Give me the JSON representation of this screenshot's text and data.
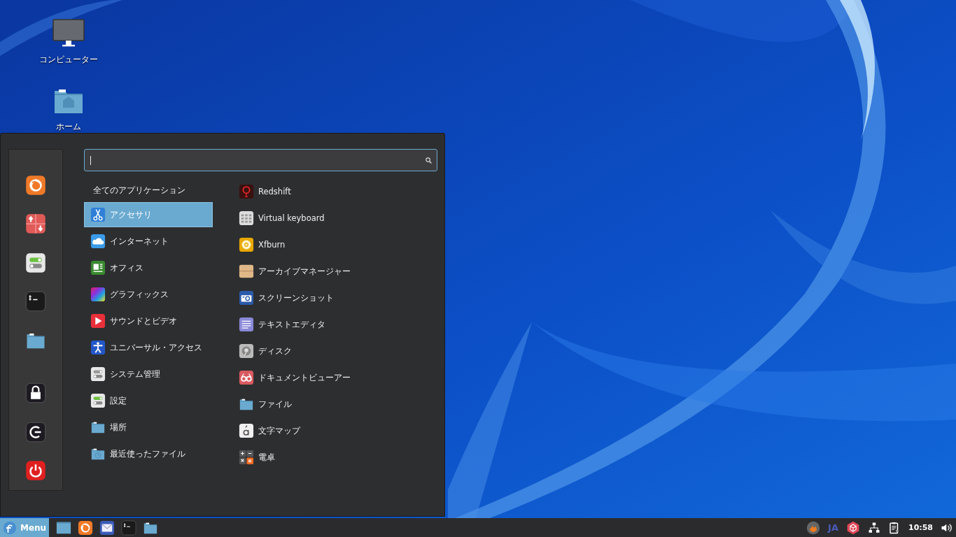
{
  "desktop_icons": [
    {
      "label": "コンピューター"
    },
    {
      "label": "ホーム"
    }
  ],
  "menu": {
    "categories_header": "全てのアプリケーション",
    "categories": [
      {
        "label": "アクセサリ",
        "selected": true
      },
      {
        "label": "インターネット",
        "selected": false
      },
      {
        "label": "オフィス",
        "selected": false
      },
      {
        "label": "グラフィックス",
        "selected": false
      },
      {
        "label": "サウンドとビデオ",
        "selected": false
      },
      {
        "label": "ユニバーサル・アクセス",
        "selected": false
      },
      {
        "label": "システム管理",
        "selected": false
      },
      {
        "label": "設定",
        "selected": false
      },
      {
        "label": "場所",
        "selected": false
      },
      {
        "label": "最近使ったファイル",
        "selected": false
      }
    ],
    "applications": [
      {
        "label": "Redshift"
      },
      {
        "label": "Virtual keyboard"
      },
      {
        "label": "Xfburn"
      },
      {
        "label": "アーカイブマネージャー"
      },
      {
        "label": "スクリーンショット"
      },
      {
        "label": "テキストエディタ"
      },
      {
        "label": "ディスク"
      },
      {
        "label": "ドキュメントビューアー"
      },
      {
        "label": "ファイル"
      },
      {
        "label": "文字マップ"
      },
      {
        "label": "電卓"
      }
    ]
  },
  "taskbar": {
    "menu_button": "Menu",
    "keyboard_layout": "JA",
    "clock": "10:58"
  }
}
